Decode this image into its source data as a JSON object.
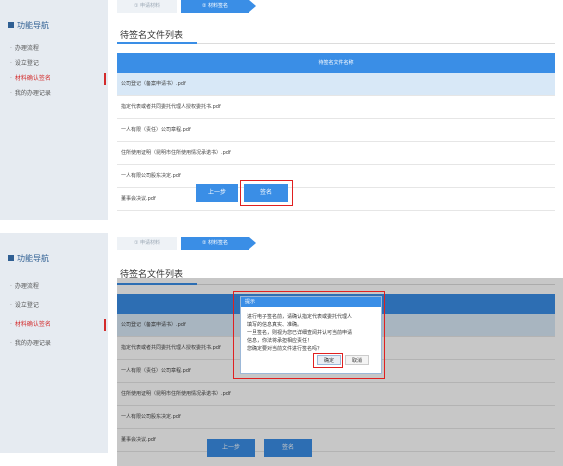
{
  "sidebar": {
    "title": "功能导航",
    "items": [
      {
        "label": "办理流程"
      },
      {
        "label": "设立登记"
      },
      {
        "label": "材料确认签名"
      },
      {
        "label": "我的办理记录"
      }
    ],
    "bullet": "·"
  },
  "steps": {
    "step1": "① 申请材料",
    "step2": "② 材料签名"
  },
  "content": {
    "title": "待签名文件列表",
    "column_header": "待签名文件名称",
    "files": [
      "公司登记（备案申请书）.pdf",
      "指定代表或者共同委托代理人授权委托书.pdf",
      "一人有限（责任）公司章程.pdf",
      "住所使用证明（昆明市住所使用情况承诺书）.pdf",
      "一人有限公司股东决定.pdf",
      "董事会决议.pdf"
    ],
    "prev_button": "上一步",
    "sign_button": "签名"
  },
  "dialog": {
    "title": "提示",
    "line1": "进行电子签名前，请确认指定代表或委托代理人",
    "line2": "填写的信息真实、准确。",
    "line3": "一旦签名，则视为您已详细查阅并认可当前申请",
    "line4": "信息，你法将承担相应责任！",
    "line5": "您确定要对当前文件进行签名吗？",
    "ok": "确定",
    "cancel": "取消"
  }
}
